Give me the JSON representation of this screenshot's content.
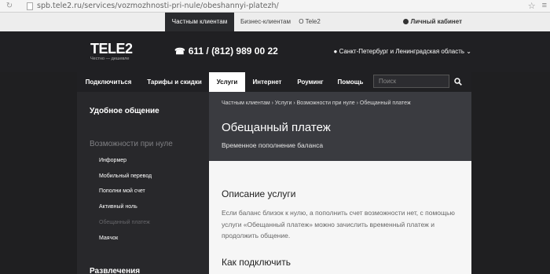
{
  "browser": {
    "url": "spb.tele2.ru/services/vozmozhnosti-pri-nule/obeshannyi-platezh/"
  },
  "topbar": {
    "tabs": [
      "Частным клиентам",
      "Бизнес-клиентам",
      "О Tele2"
    ],
    "account": "Личный кабинет"
  },
  "header": {
    "logo": "TELE2",
    "logo_sub": "Честно — дешевле",
    "phone": "611 / (812) 989 00 22",
    "region": "Санкт-Петербург и Ленинградская область"
  },
  "nav": {
    "items": [
      "Подключиться",
      "Тарифы и скидки",
      "Услуги",
      "Интернет",
      "Роуминг",
      "Помощь"
    ],
    "search_placeholder": "Поиск"
  },
  "sidebar": {
    "section1": "Удобное общение",
    "section2": "Возможности при нуле",
    "items": [
      "Информер",
      "Мобильный перевод",
      "Пополни мой счет",
      "Активный ноль",
      "Обещанный платеж",
      "Маячок"
    ],
    "section3": "Развлечения"
  },
  "content": {
    "breadcrumb": "Частным клиентам  ›  Услуги  ›  Возможности при нуле  ›  Обещанный платеж",
    "title": "Обещанный платеж",
    "subtitle": "Временное пополнение баланса",
    "desc_title": "Описание услуги",
    "desc_text": "Если баланс близок к нулю, а пополнить счет возможности нет, с помощью услуги «Обещанный платеж» можно зачислить временный платеж и продолжить общение.",
    "how_title": "Как подключить"
  }
}
